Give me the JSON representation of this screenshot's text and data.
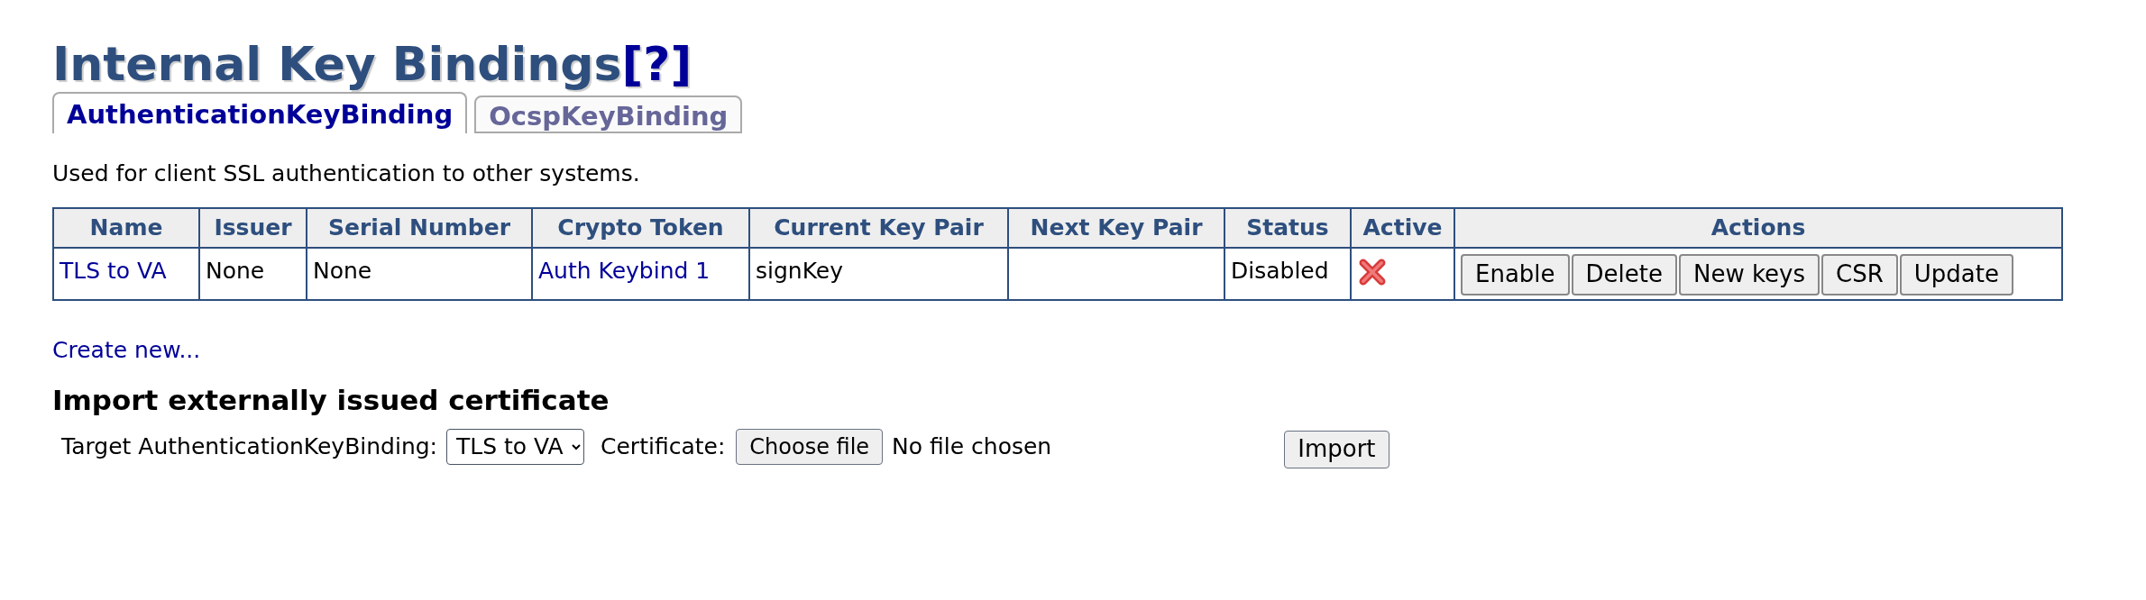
{
  "title": {
    "text": "Internal Key Bindings",
    "help": "[?]"
  },
  "tabs": [
    {
      "label": "AuthenticationKeyBinding",
      "selected": true
    },
    {
      "label": "OcspKeyBinding",
      "selected": false
    }
  ],
  "description": "Used for client SSL authentication to other systems.",
  "table": {
    "columns": [
      "Name",
      "Issuer",
      "Serial Number",
      "Crypto Token",
      "Current Key Pair",
      "Next Key Pair",
      "Status",
      "Active",
      "Actions"
    ],
    "rows": [
      {
        "name": "TLS to VA",
        "issuer": "None",
        "serial_number": "None",
        "crypto_token": "Auth Keybind 1",
        "current_key_pair": "signKey",
        "status": "Disabled",
        "active": false,
        "actions": [
          "Enable",
          "Delete",
          "New keys",
          "CSR",
          "Update"
        ]
      }
    ]
  },
  "create_link": "Create new...",
  "import_section": {
    "heading": "Import externally issued certificate",
    "target_label": "Target AuthenticationKeyBinding:",
    "target_value": "TLS to VA",
    "certificate_label": "Certificate:",
    "file_button": "Choose file",
    "file_status": "No file chosen",
    "import_button": "Import"
  }
}
